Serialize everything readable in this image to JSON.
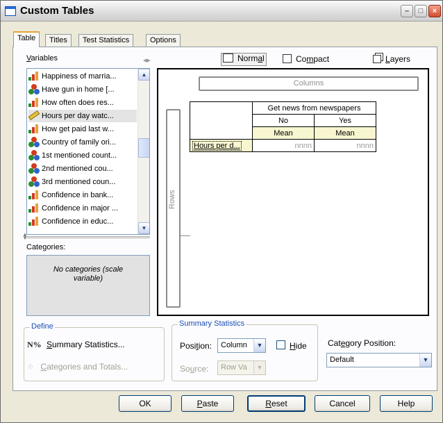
{
  "window": {
    "title": "Custom Tables"
  },
  "tabs": [
    "Table",
    "Titles",
    "Test Statistics",
    "Options"
  ],
  "variables": {
    "label": "Variables",
    "items": [
      {
        "label": "Happiness of marria...",
        "icon": "ordinal"
      },
      {
        "label": "Have gun in home [...",
        "icon": "nominal"
      },
      {
        "label": "How often does res...",
        "icon": "ordinal"
      },
      {
        "label": "Hours per day watc...",
        "icon": "scale",
        "selected": true
      },
      {
        "label": "How get paid last w...",
        "icon": "ordinal"
      },
      {
        "label": "Country of family ori...",
        "icon": "nominal"
      },
      {
        "label": "1st mentioned count...",
        "icon": "nominal"
      },
      {
        "label": "2nd mentioned cou...",
        "icon": "nominal"
      },
      {
        "label": "3rd mentioned coun...",
        "icon": "nominal"
      },
      {
        "label": "Confidence in bank...",
        "icon": "ordinal"
      },
      {
        "label": "Confidence in major ...",
        "icon": "ordinal"
      },
      {
        "label": "Confidence in educ...",
        "icon": "ordinal"
      }
    ]
  },
  "categories": {
    "label": "Categories:",
    "empty_text": "No categories (scale variable)"
  },
  "view": {
    "normal": "Normal",
    "compact": "Compact",
    "layers": "Layers",
    "active": "normal"
  },
  "canvas": {
    "columns_label": "Columns",
    "rows_label": "Rows",
    "table": {
      "column_variable": "Get news from newspapers",
      "column_categories": [
        "No",
        "Yes"
      ],
      "statistic": "Mean",
      "row_variable": "Hours per d...",
      "placeholder": "nnnn"
    }
  },
  "define": {
    "group_label": "Define",
    "summary_stats_button": "Summary Statistics...",
    "categories_totals_button": "Categories and Totals...",
    "summary_icon_text": "N%"
  },
  "summary_statistics": {
    "group_label": "Summary Statistics",
    "position_label": "Position:",
    "position_value": "Column",
    "hide_label": "Hide",
    "source_label": "Source:",
    "source_value": "Row Va"
  },
  "category_position": {
    "label": "Category Position:",
    "value": "Default"
  },
  "buttons": {
    "ok": "OK",
    "paste": "Paste",
    "reset": "Reset",
    "cancel": "Cancel",
    "help": "Help"
  },
  "colors": {
    "selection_accent": "#e5a336",
    "mean_cell_bg": "#f7f6d0",
    "group_title": "#1a4eb5"
  }
}
